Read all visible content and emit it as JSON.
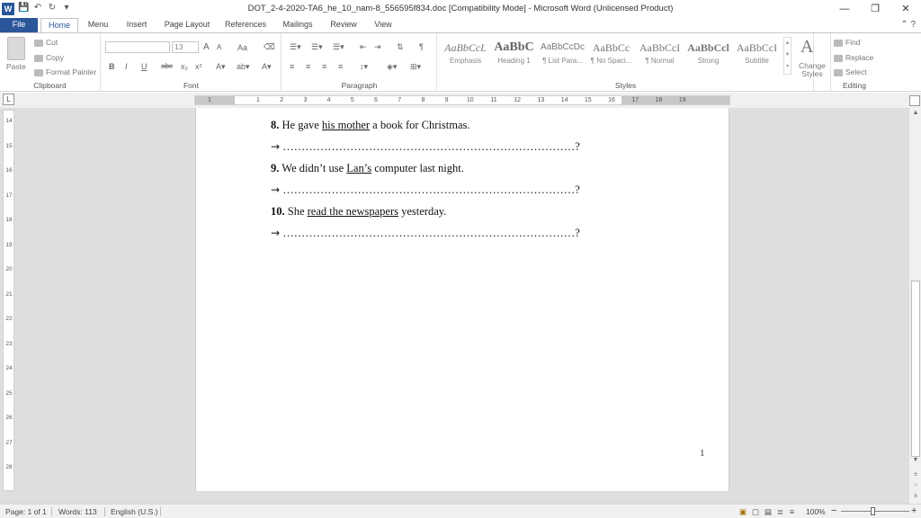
{
  "window": {
    "app_icon": "W",
    "title": "DOT_2-4-2020-TA6_he_10_nam-8_556595f834.doc [Compatibility Mode]  -  Microsoft Word (Unlicensed Product)",
    "minimize": "—",
    "maximize": "❐",
    "close": "✕"
  },
  "tabs": [
    "File",
    "Home",
    "Menu",
    "Insert",
    "Page Layout",
    "References",
    "Mailings",
    "Review",
    "View"
  ],
  "active_tab": "Home",
  "ribbon": {
    "clipboard": {
      "paste": "Paste",
      "cut": "Cut",
      "copy": "Copy",
      "format_painter": "Format Painter",
      "label": "Clipboard"
    },
    "font": {
      "font_name": "",
      "font_size": "13",
      "grow": "A",
      "shrink": "A",
      "change_case": "Aa",
      "bold": "B",
      "italic": "I",
      "underline": "U",
      "strike": "abc",
      "subscript": "x₂",
      "superscript": "x²",
      "label": "Font"
    },
    "paragraph": {
      "label": "Paragraph",
      "pilcrow": "¶"
    },
    "styles": {
      "label": "Styles",
      "items": [
        {
          "sample": "AaBbCcL",
          "name": "Emphasis"
        },
        {
          "sample": "AaBbC",
          "name": "Heading 1"
        },
        {
          "sample": "AaBbCcDc",
          "name": "¶ List Para..."
        },
        {
          "sample": "AaBbCc",
          "name": "¶ No Spaci..."
        },
        {
          "sample": "AaBbCcI",
          "name": "¶ Normal"
        },
        {
          "sample": "AaBbCcl",
          "name": "Strong"
        },
        {
          "sample": "AaBbCcI",
          "name": "Subtitle"
        }
      ],
      "change_styles": "Change Styles"
    },
    "editing": {
      "find": "Find",
      "replace": "Replace",
      "select": "Select",
      "label": "Editing"
    }
  },
  "ruler": {
    "corner": "L",
    "h_numbers": [
      "1",
      "1",
      "2",
      "3",
      "4",
      "5",
      "6",
      "7",
      "8",
      "9",
      "10",
      "11",
      "12",
      "13",
      "14",
      "15",
      "16",
      "17",
      "18",
      "19"
    ],
    "v_numbers": [
      "14",
      "15",
      "16",
      "17",
      "18",
      "19",
      "20",
      "21",
      "22",
      "23",
      "24",
      "25",
      "26",
      "27",
      "28"
    ]
  },
  "document": {
    "items": [
      {
        "num": "8.",
        "pre": " He gave ",
        "underlined": "his mother",
        "post": " a book for Christmas."
      },
      {
        "num": "9.",
        "pre": " We didn’t use ",
        "underlined": "Lan’s",
        "post": " computer last night."
      },
      {
        "num": "10.",
        "pre": " She ",
        "underlined": "read the newspapers",
        "post": " yesterday."
      }
    ],
    "answer_arrow": "→",
    "answer_dots": "……………………………………………………………………?",
    "page_number": "1"
  },
  "status": {
    "page": "Page: 1 of 1",
    "words": "Words: 113",
    "language": "English (U.S.)",
    "zoom": "100%",
    "zoom_minus": "−",
    "zoom_plus": "+"
  }
}
